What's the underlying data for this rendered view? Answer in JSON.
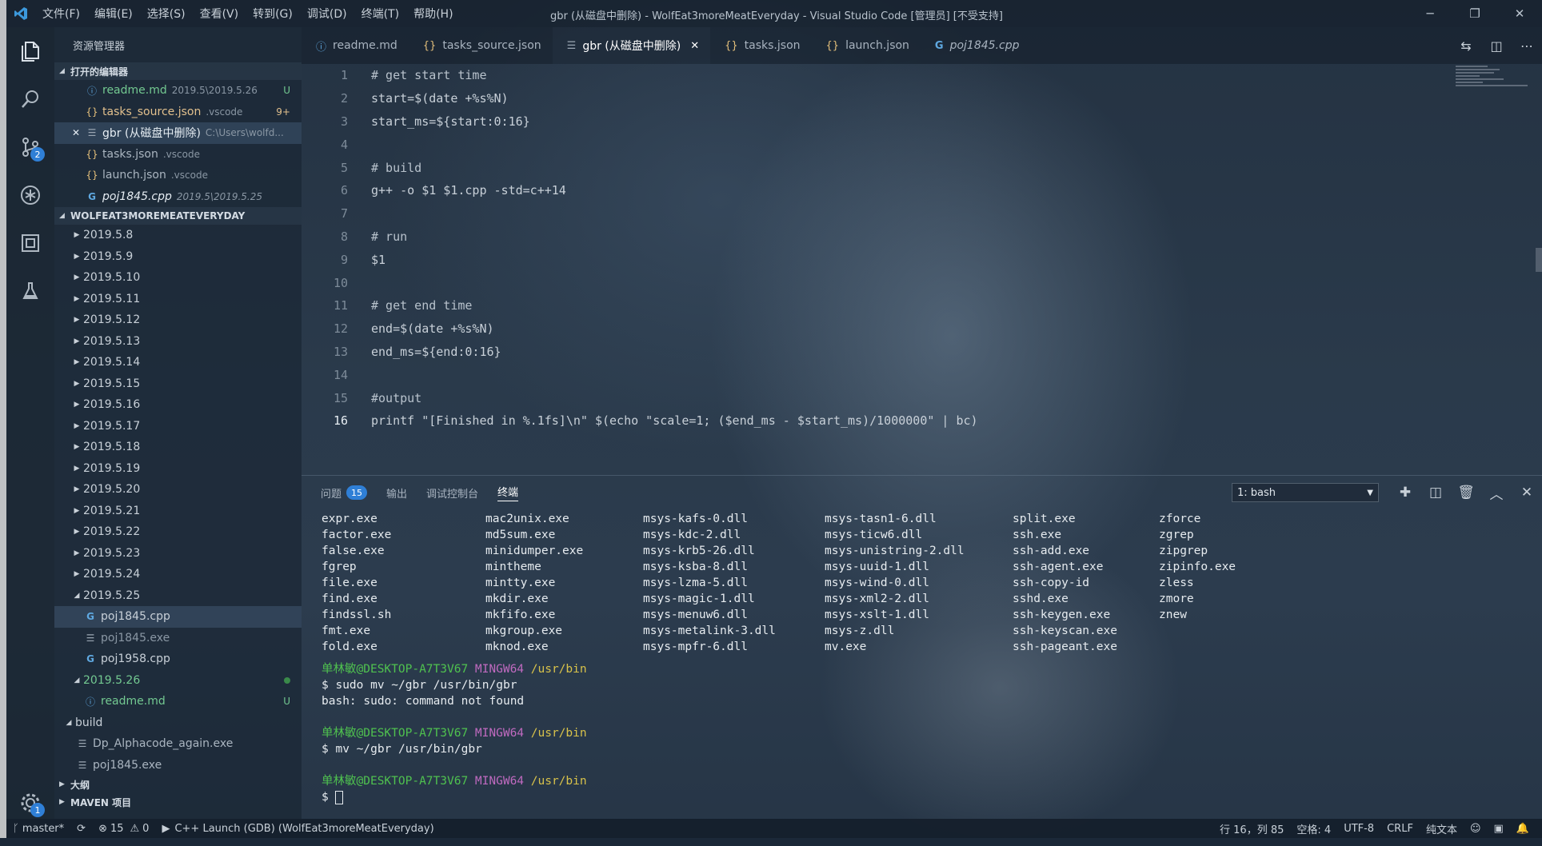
{
  "window": {
    "title": "gbr (从磁盘中删除) - WolfEat3moreMeatEveryday - Visual Studio Code [管理员] [不受支持]",
    "logo": "vscode-logo",
    "menu": [
      "文件(F)",
      "编辑(E)",
      "选择(S)",
      "查看(V)",
      "转到(G)",
      "调试(D)",
      "终端(T)",
      "帮助(H)"
    ],
    "controls": {
      "minimize": "─",
      "restore": "❐",
      "close": "✕"
    }
  },
  "activity_bar": {
    "items": [
      {
        "icon": "files-icon"
      },
      {
        "icon": "search-icon"
      },
      {
        "icon": "source-control-icon",
        "badge": "2"
      },
      {
        "icon": "debug-icon"
      },
      {
        "icon": "extensions-icon"
      },
      {
        "icon": "flask-icon"
      }
    ],
    "settings": {
      "icon": "gear-icon",
      "badge": "1"
    }
  },
  "sidebar": {
    "title": "资源管理器",
    "open_editors": {
      "header": "打开的编辑器",
      "items": [
        {
          "icon": "info-icon",
          "name": "readme.md",
          "desc": "2019.5\\2019.5.26",
          "deco": "U",
          "color": "#73c991"
        },
        {
          "icon": "json-icon",
          "name": "tasks_source.json",
          "desc": ".vscode",
          "deco": "9+",
          "color": "#e2c08d"
        },
        {
          "icon": "lines-icon",
          "name": "gbr (从磁盘中删除)",
          "desc": "C:\\Users\\wolfd...",
          "deco": "",
          "color": "#e6edf3",
          "close": "✕"
        },
        {
          "icon": "json-icon",
          "name": "tasks.json",
          "desc": ".vscode",
          "deco": "",
          "color": "#aab5c0"
        },
        {
          "icon": "json-icon",
          "name": "launch.json",
          "desc": ".vscode",
          "deco": "",
          "color": "#aab5c0"
        },
        {
          "icon": "cpp-icon",
          "name": "poj1845.cpp",
          "desc": "2019.5\\2019.5.25",
          "deco": "",
          "color": "#e6edf3"
        }
      ]
    },
    "workspace": {
      "header": "WOLFEAT3MOREMEATEVERYDAY",
      "folders": [
        "2019.5.8",
        "2019.5.9",
        "2019.5.10",
        "2019.5.11",
        "2019.5.12",
        "2019.5.13",
        "2019.5.14",
        "2019.5.15",
        "2019.5.16",
        "2019.5.17",
        "2019.5.18",
        "2019.5.19",
        "2019.5.20",
        "2019.5.21",
        "2019.5.22",
        "2019.5.23",
        "2019.5.24"
      ],
      "expanded_folder": "2019.5.25",
      "expanded_children": [
        "poj1845.cpp",
        "poj1845.exe",
        "poj1958.cpp"
      ],
      "folder_26": "2019.5.26",
      "folder_26_child": "readme.md",
      "folder_26_child_deco": "U",
      "build_folder": "build",
      "build_children": [
        "Dp_Alphacode_again.exe",
        "poj1845.exe"
      ]
    },
    "outline_header": "大纲",
    "maven_header": "MAVEN 项目"
  },
  "tabs": [
    {
      "icon": "info-icon",
      "label": "readme.md",
      "active": false
    },
    {
      "icon": "json-icon",
      "label": "tasks_source.json",
      "active": false
    },
    {
      "icon": "lines-icon",
      "label": "gbr (从磁盘中删除)",
      "active": true,
      "close": "✕"
    },
    {
      "icon": "json-icon",
      "label": "tasks.json",
      "active": false
    },
    {
      "icon": "json-icon",
      "label": "launch.json",
      "active": false
    },
    {
      "icon": "cpp-icon",
      "label": "poj1845.cpp",
      "active": false
    }
  ],
  "editor": {
    "lines": [
      "# get start time",
      "start=$(date +%s%N)",
      "start_ms=${start:0:16}",
      "",
      "# build",
      "g++ -o $1 $1.cpp -std=c++14",
      "",
      "# run",
      "$1",
      "",
      "# get end time",
      "end=$(date +%s%N)",
      "end_ms=${end:0:16}",
      "",
      "#output",
      "printf \"[Finished in %.1fs]\\n\" $(echo \"scale=1; ($end_ms - $start_ms)/1000000\" | bc)"
    ],
    "current_line": 16
  },
  "panel": {
    "tabs": [
      {
        "label": "问题",
        "badge": "15"
      },
      {
        "label": "输出"
      },
      {
        "label": "调试控制台"
      },
      {
        "label": "终端",
        "active": true
      }
    ],
    "terminal_select": "1: bash",
    "select_arrow": "▼",
    "terminal": {
      "ls_columns": [
        [
          "expr.exe",
          "factor.exe",
          "false.exe",
          "fgrep",
          "file.exe",
          "find.exe",
          "findssl.sh",
          "fmt.exe",
          "fold.exe"
        ],
        [
          "mac2unix.exe",
          "md5sum.exe",
          "minidumper.exe",
          "mintheme",
          "mintty.exe",
          "mkdir.exe",
          "mkfifo.exe",
          "mkgroup.exe",
          "mknod.exe"
        ],
        [
          "msys-kafs-0.dll",
          "msys-kdc-2.dll",
          "msys-krb5-26.dll",
          "msys-ksba-8.dll",
          "msys-lzma-5.dll",
          "msys-magic-1.dll",
          "msys-menuw6.dll",
          "msys-metalink-3.dll",
          "msys-mpfr-6.dll"
        ],
        [
          "msys-tasn1-6.dll",
          "msys-ticw6.dll",
          "msys-unistring-2.dll",
          "msys-uuid-1.dll",
          "msys-wind-0.dll",
          "msys-xml2-2.dll",
          "msys-xslt-1.dll",
          "msys-z.dll",
          "mv.exe"
        ],
        [
          "split.exe",
          "ssh.exe",
          "ssh-add.exe",
          "ssh-agent.exe",
          "ssh-copy-id",
          "sshd.exe",
          "ssh-keygen.exe",
          "ssh-keyscan.exe",
          "ssh-pageant.exe"
        ],
        [
          "zforce",
          "zgrep",
          "zipgrep",
          "zipinfo.exe",
          "zless",
          "zmore",
          "znew"
        ]
      ],
      "prompt_user": "单林敏@DESKTOP-A7T3V67",
      "prompt_host": "MINGW64",
      "prompt_path": "/usr/bin",
      "cmd1": "$ sudo mv ~/gbr /usr/bin/gbr",
      "out1": "bash: sudo: command not found",
      "cmd2": "$ mv ~/gbr /usr/bin/gbr",
      "cmd3": "$ "
    }
  },
  "statusbar": {
    "branch": "master*",
    "errors": "15",
    "warnings": "0",
    "launch": "C++ Launch (GDB) (WolfEat3moreMeatEveryday)",
    "position": "行 16，列 85",
    "spaces": "空格: 4",
    "encoding": "UTF-8",
    "eol": "CRLF",
    "language": "纯文本"
  },
  "colors": {
    "accent": "#2f7fd6",
    "prompt_user": "#4fc14f",
    "prompt_host": "#c06ac0",
    "prompt_path": "#d8c24a",
    "modified": "#e2c08d",
    "untracked": "#73c991"
  }
}
